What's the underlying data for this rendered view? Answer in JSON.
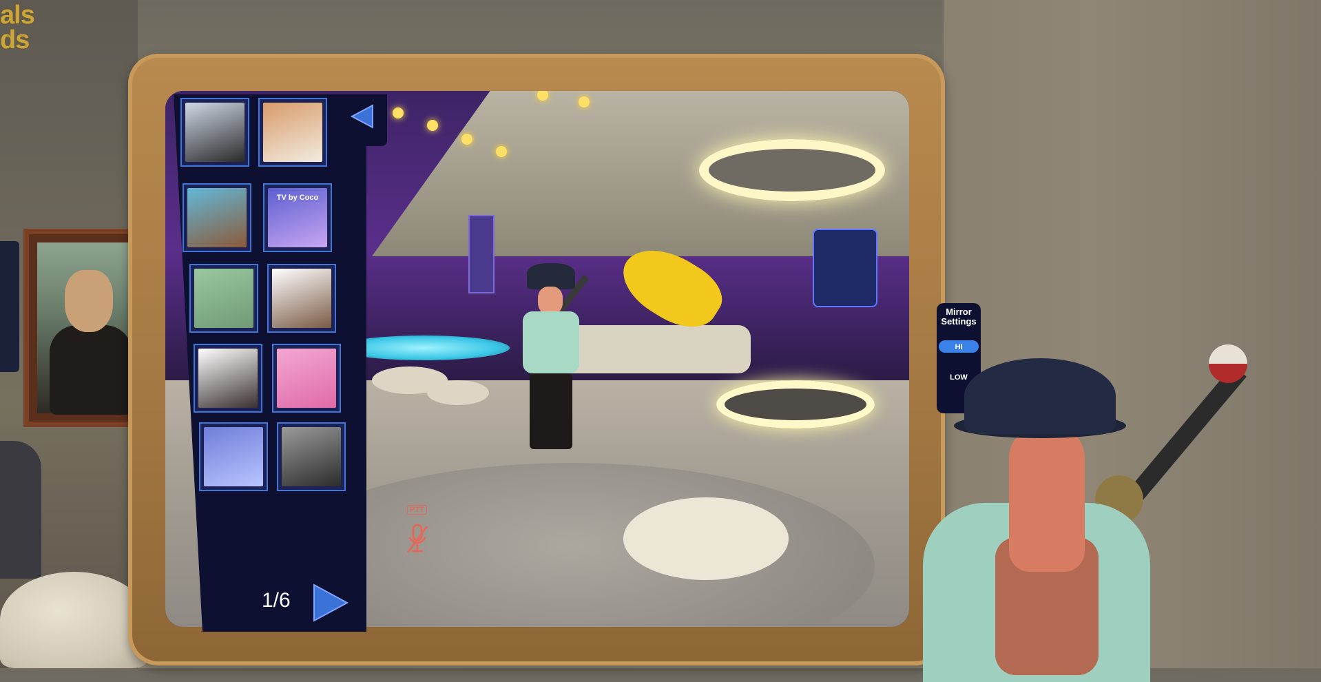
{
  "logo": {
    "line1": "als",
    "line2": "ds"
  },
  "gallery": {
    "back_icon": "triangle-left-icon",
    "thumbnails": [
      {
        "name": "thumb-1",
        "colors": [
          "#cfd8e6",
          "#2a2a2a"
        ]
      },
      {
        "name": "thumb-2",
        "colors": [
          "#d99b6a",
          "#f1ece0"
        ]
      },
      {
        "name": "thumb-3",
        "colors": [
          "#62b8d8",
          "#8b5a3a"
        ]
      },
      {
        "name": "thumb-4",
        "colors": [
          "#5b5fd0",
          "#c9a6f2"
        ],
        "caption": "TV by Coco"
      },
      {
        "name": "thumb-5",
        "colors": [
          "#9bc7a0",
          "#6f9a75"
        ]
      },
      {
        "name": "thumb-6",
        "colors": [
          "#ffffff",
          "#7a5a44"
        ]
      },
      {
        "name": "thumb-7",
        "colors": [
          "#ffffff",
          "#3a3030"
        ]
      },
      {
        "name": "thumb-8",
        "colors": [
          "#f2a8d2",
          "#e06aa9"
        ]
      },
      {
        "name": "thumb-9",
        "colors": [
          "#6f7fd8",
          "#b9c4ff"
        ]
      },
      {
        "name": "thumb-10",
        "colors": [
          "#9a9a9a",
          "#2c2c2c"
        ]
      }
    ],
    "page_indicator": "1/6",
    "next_icon": "triangle-right-icon"
  },
  "mirror_settings": {
    "title_line1": "Mirror",
    "title_line2": "Settings",
    "hi_label": "HI",
    "low_label": "LOW"
  },
  "voice": {
    "ptt_label": "PTT",
    "mic_icon": "mic-muted-icon"
  },
  "colors": {
    "panel_bg": "#0d1030",
    "accent": "#3e76d9",
    "frame": "#b88a4e"
  }
}
